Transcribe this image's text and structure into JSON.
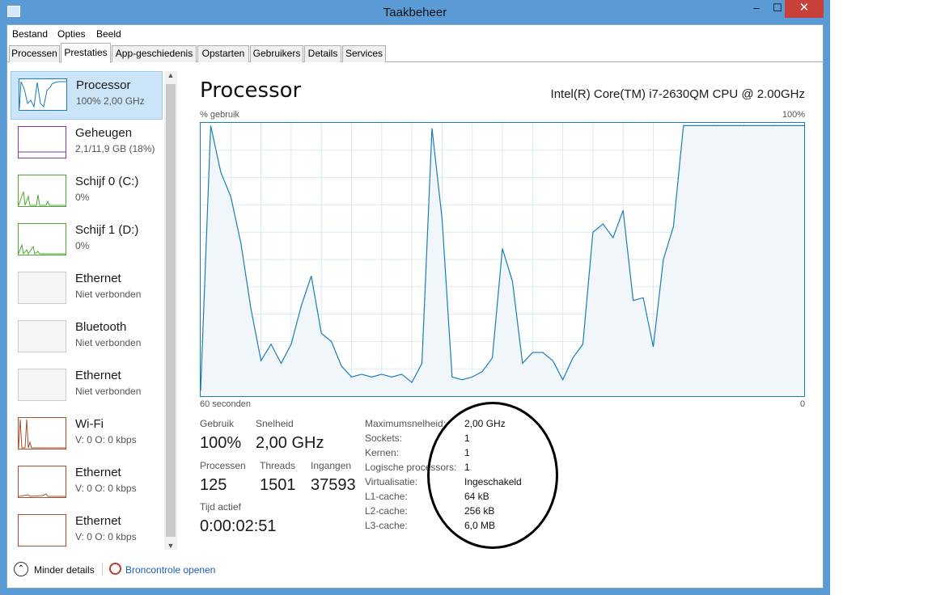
{
  "window": {
    "title": "Taakbeheer",
    "min_glyph": "–",
    "max_glyph": "☐",
    "close_glyph": "✕"
  },
  "menu": [
    "Bestand",
    "Opties",
    "Beeld"
  ],
  "tabs": [
    "Processen",
    "Prestaties",
    "App-geschiedenis",
    "Opstarten",
    "Gebruikers",
    "Details",
    "Services"
  ],
  "sidebar": [
    {
      "name": "Processor",
      "sub": "100% 2,00 GHz",
      "color": "#1a7db8",
      "selected": true
    },
    {
      "name": "Geheugen",
      "sub": "2,1/11,9 GB (18%)",
      "color": "#8b3a9c"
    },
    {
      "name": "Schijf 0 (C:)",
      "sub": "0%",
      "color": "#4ca832"
    },
    {
      "name": "Schijf 1 (D:)",
      "sub": "0%",
      "color": "#4ca832"
    },
    {
      "name": "Ethernet",
      "sub": "Niet verbonden",
      "color": "#cccccc"
    },
    {
      "name": "Bluetooth",
      "sub": "Niet verbonden",
      "color": "#cccccc"
    },
    {
      "name": "Ethernet",
      "sub": "Niet verbonden",
      "color": "#cccccc"
    },
    {
      "name": "Wi-Fi",
      "sub": "V: 0 O: 0 kbps",
      "color": "#a0522d"
    },
    {
      "name": "Ethernet",
      "sub": "V: 0 O: 0 kbps",
      "color": "#a0522d"
    },
    {
      "name": "Ethernet",
      "sub": "V: 0 O: 0 kbps",
      "color": "#a0522d"
    }
  ],
  "main": {
    "heading": "Processor",
    "cpu_name": "Intel(R) Core(TM) i7-2630QM CPU @ 2.00GHz",
    "y_label": "% gebruik",
    "y_max": "100%",
    "x_left": "60 seconden",
    "x_right": "0"
  },
  "stats": {
    "gebruik_lbl": "Gebruik",
    "gebruik": "100%",
    "snelheid_lbl": "Snelheid",
    "snelheid": "2,00 GHz",
    "processen_lbl": "Processen",
    "processen": "125",
    "threads_lbl": "Threads",
    "threads": "1501",
    "ingangen_lbl": "Ingangen",
    "ingangen": "37593",
    "tijd_lbl": "Tijd actief",
    "tijd": "0:00:02:51"
  },
  "details": [
    {
      "label": "Maximumsnelheid:",
      "value": "2,00 GHz"
    },
    {
      "label": "Sockets:",
      "value": "1"
    },
    {
      "label": "Kernen:",
      "value": "1"
    },
    {
      "label": "Logische processors:",
      "value": "1"
    },
    {
      "label": "Virtualisatie:",
      "value": "Ingeschakeld"
    },
    {
      "label": "L1-cache:",
      "value": "64 kB"
    },
    {
      "label": "L2-cache:",
      "value": "256 kB"
    },
    {
      "label": "L3-cache:",
      "value": "6,0 MB"
    }
  ],
  "footer": {
    "less_details": "Minder details",
    "resource_monitor": "Broncontrole openen"
  },
  "chart_data": {
    "type": "area",
    "ylabel": "% gebruik",
    "ylim": [
      0,
      100
    ],
    "x_range_seconds": [
      60,
      0
    ],
    "values": [
      2,
      99,
      82,
      73,
      56,
      32,
      13,
      19,
      12,
      19,
      33,
      44,
      23,
      20,
      11,
      7,
      8,
      7,
      8,
      7,
      8,
      5,
      12,
      98,
      65,
      7,
      6,
      7,
      9,
      14,
      54,
      42,
      12,
      16,
      16,
      13,
      6,
      14,
      19,
      60,
      63,
      58,
      68,
      35,
      36,
      18,
      50,
      62,
      99,
      99,
      99,
      99,
      99,
      99,
      99,
      99,
      99,
      99,
      99,
      99,
      99
    ]
  }
}
